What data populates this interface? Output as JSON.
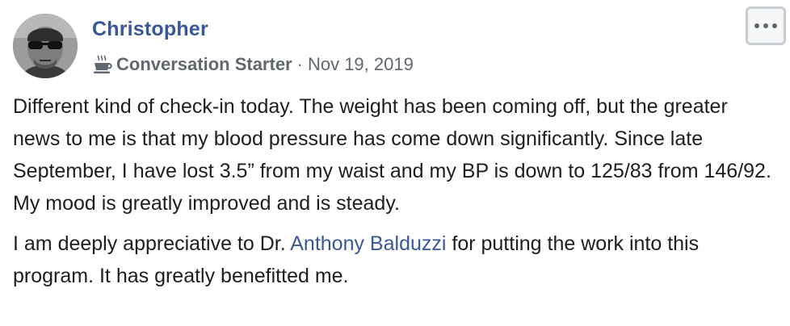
{
  "author": {
    "name": "Christopher",
    "badge_icon": "coffee-cup-icon",
    "badge_label": "Conversation Starter",
    "separator": "·",
    "date": "Nov 19, 2019"
  },
  "menu": {
    "icon": "ellipsis-icon"
  },
  "body": {
    "paragraph1": "Different kind of check-in today. The weight has been coming off, but the greater news to me is that my blood pressure has come down significantly. Since late September, I have lost 3.5” from my waist and my BP is down to 125/83 from 146/92. My mood is greatly improved and is steady.",
    "paragraph2_before": "I am deeply appreciative to Dr. ",
    "paragraph2_mention": "Anthony Balduzzi",
    "paragraph2_after": " for putting the work into this program. It has greatly benefitted me."
  },
  "colors": {
    "link": "#385898",
    "meta": "#606770",
    "text": "#1c1e21"
  }
}
